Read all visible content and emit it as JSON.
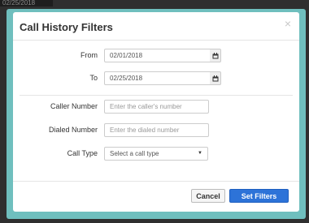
{
  "background": {
    "tab_text": "02/25/2018"
  },
  "modal": {
    "title": "Call History Filters",
    "close_symbol": "×"
  },
  "form": {
    "from": {
      "label": "From",
      "value": "02/01/2018"
    },
    "to": {
      "label": "To",
      "value": "02/25/2018"
    },
    "caller_number": {
      "label": "Caller Number",
      "placeholder": "Enter the caller's number"
    },
    "dialed_number": {
      "label": "Dialed Number",
      "placeholder": "Enter the dialed number"
    },
    "call_type": {
      "label": "Call Type",
      "selected": "Select a call type"
    }
  },
  "footer": {
    "cancel_label": "Cancel",
    "submit_label": "Set Filters"
  },
  "colors": {
    "frame": "#6fbfbe",
    "primary": "#2d73d8"
  },
  "icons": {
    "date": "calendar-icon",
    "select": "chevron-down-icon",
    "close": "close-icon"
  }
}
